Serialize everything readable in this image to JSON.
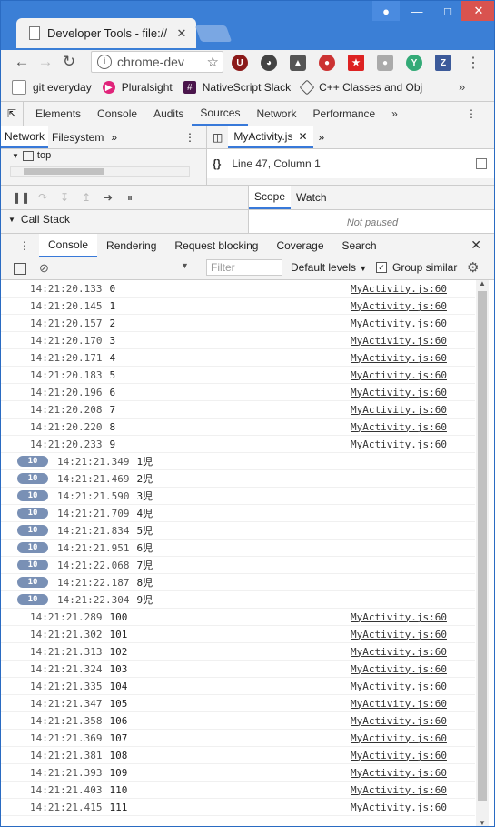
{
  "browser": {
    "tab_title": "Developer Tools - file://",
    "url": "chrome-dev",
    "bookmarks": [
      "git everyday",
      "Pluralsight",
      "NativeScript Slack",
      "C++ Classes and Obj"
    ]
  },
  "devtools": {
    "tabs": [
      "Elements",
      "Console",
      "Audits",
      "Sources",
      "Network",
      "Performance"
    ],
    "selected_tab": "Sources",
    "nav_tabs": [
      "Network",
      "Filesystem"
    ],
    "tree_item": "top",
    "editor_tab": "MyActivity.js",
    "cursor_position": "Line 47, Column 1",
    "call_stack_label": "Call Stack",
    "scope_tabs": [
      "Scope",
      "Watch"
    ],
    "not_paused": "Not paused",
    "drawer_tabs": [
      "Console",
      "Rendering",
      "Request blocking",
      "Coverage",
      "Search"
    ],
    "filter_placeholder": "Filter",
    "levels_label": "Default levels",
    "group_similar_label": "Group similar"
  },
  "console": {
    "rows": [
      {
        "ts": "14:21:20.133",
        "msg": "0",
        "src": "MyActivity.js:60"
      },
      {
        "ts": "14:21:20.145",
        "msg": "1",
        "src": "MyActivity.js:60"
      },
      {
        "ts": "14:21:20.157",
        "msg": "2",
        "src": "MyActivity.js:60"
      },
      {
        "ts": "14:21:20.170",
        "msg": "3",
        "src": "MyActivity.js:60"
      },
      {
        "ts": "14:21:20.171",
        "msg": "4",
        "src": "MyActivity.js:60"
      },
      {
        "ts": "14:21:20.183",
        "msg": "5",
        "src": "MyActivity.js:60"
      },
      {
        "ts": "14:21:20.196",
        "msg": "6",
        "src": "MyActivity.js:60"
      },
      {
        "ts": "14:21:20.208",
        "msg": "7",
        "src": "MyActivity.js:60"
      },
      {
        "ts": "14:21:20.220",
        "msg": "8",
        "src": "MyActivity.js:60"
      },
      {
        "ts": "14:21:20.233",
        "msg": "9",
        "src": "MyActivity.js:60"
      },
      {
        "badge": "10",
        "ts": "14:21:21.349",
        "msg": "1児"
      },
      {
        "badge": "10",
        "ts": "14:21:21.469",
        "msg": "2児"
      },
      {
        "badge": "10",
        "ts": "14:21:21.590",
        "msg": "3児"
      },
      {
        "badge": "10",
        "ts": "14:21:21.709",
        "msg": "4児"
      },
      {
        "badge": "10",
        "ts": "14:21:21.834",
        "msg": "5児"
      },
      {
        "badge": "10",
        "ts": "14:21:21.951",
        "msg": "6児"
      },
      {
        "badge": "10",
        "ts": "14:21:22.068",
        "msg": "7児"
      },
      {
        "badge": "10",
        "ts": "14:21:22.187",
        "msg": "8児"
      },
      {
        "badge": "10",
        "ts": "14:21:22.304",
        "msg": "9児"
      },
      {
        "ts": "14:21:21.289",
        "msg": "100",
        "src": "MyActivity.js:60"
      },
      {
        "ts": "14:21:21.302",
        "msg": "101",
        "src": "MyActivity.js:60"
      },
      {
        "ts": "14:21:21.313",
        "msg": "102",
        "src": "MyActivity.js:60"
      },
      {
        "ts": "14:21:21.324",
        "msg": "103",
        "src": "MyActivity.js:60"
      },
      {
        "ts": "14:21:21.335",
        "msg": "104",
        "src": "MyActivity.js:60"
      },
      {
        "ts": "14:21:21.347",
        "msg": "105",
        "src": "MyActivity.js:60"
      },
      {
        "ts": "14:21:21.358",
        "msg": "106",
        "src": "MyActivity.js:60"
      },
      {
        "ts": "14:21:21.369",
        "msg": "107",
        "src": "MyActivity.js:60"
      },
      {
        "ts": "14:21:21.381",
        "msg": "108",
        "src": "MyActivity.js:60"
      },
      {
        "ts": "14:21:21.393",
        "msg": "109",
        "src": "MyActivity.js:60"
      },
      {
        "ts": "14:21:21.403",
        "msg": "110",
        "src": "MyActivity.js:60"
      },
      {
        "ts": "14:21:21.415",
        "msg": "111",
        "src": "MyActivity.js:60"
      }
    ]
  }
}
